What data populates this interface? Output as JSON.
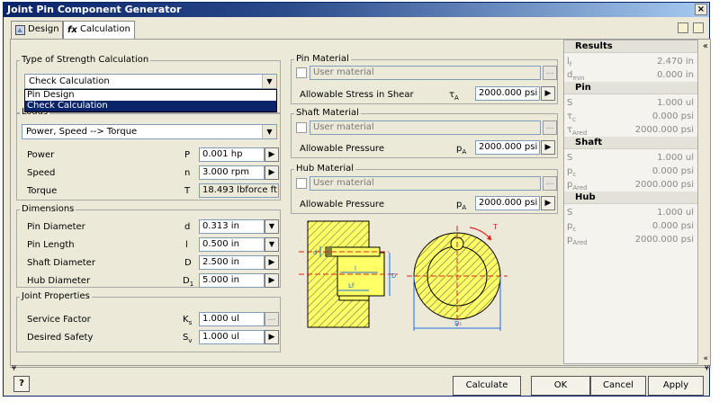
{
  "window": {
    "title": "Joint Pin Component Generator",
    "close_label": "×"
  },
  "tabs": [
    {
      "label": "Design",
      "icon": "design-tab-icon"
    },
    {
      "label": "Calculation",
      "icon": "function-fx-icon",
      "glyph": "fx"
    }
  ],
  "strength": {
    "title": "Type of Strength Calculation",
    "selected": "Check Calculation",
    "options": [
      "Pin Design",
      "Check Calculation"
    ]
  },
  "loads": {
    "title": "Loads",
    "selected": "Power, Speed --> Torque",
    "rows": [
      {
        "label": "Power",
        "symbol": "P",
        "value": "0.001 hp"
      },
      {
        "label": "Speed",
        "symbol": "n",
        "value": "3.000 rpm"
      },
      {
        "label": "Torque",
        "symbol": "T",
        "value": "18.493 lbforce ft"
      }
    ]
  },
  "dimensions": {
    "title": "Dimensions",
    "rows": [
      {
        "label": "Pin Diameter",
        "symbol": "d",
        "value": "0.313 in"
      },
      {
        "label": "Pin Length",
        "symbol": "l",
        "value": "0.500 in"
      },
      {
        "label": "Shaft Diameter",
        "symbol": "D",
        "value": "2.500 in"
      },
      {
        "label": "Hub Diameter",
        "symbol": "D",
        "sub": "1",
        "value": "5.000 in"
      }
    ]
  },
  "joint": {
    "title": "Joint Properties",
    "rows": [
      {
        "label": "Service Factor",
        "symbol": "K",
        "sub": "s",
        "value": "1.000 ul"
      },
      {
        "label": "Desired Safety",
        "symbol": "S",
        "sub": "v",
        "value": "1.000 ul"
      }
    ]
  },
  "pin_material": {
    "title": "Pin Material",
    "user_material": "User material",
    "label": "Allowable Stress in Shear",
    "symbol": "τ",
    "sub": "A",
    "value": "2000.000 psi"
  },
  "shaft_material": {
    "title": "Shaft Material",
    "user_material": "User material",
    "label": "Allowable Pressure",
    "symbol": "p",
    "sub": "A",
    "value": "2000.000 psi"
  },
  "hub_material": {
    "title": "Hub Material",
    "user_material": "User material",
    "label": "Allowable Pressure",
    "symbol": "p",
    "sub": "A",
    "value": "2000.000 psi"
  },
  "diagram": {
    "labels": {
      "d": "d",
      "l": "l",
      "lf": "Lf",
      "D": "D",
      "D1": "D₁",
      "T": "T"
    },
    "colors": {
      "fill": "#ffff66",
      "dim": "#1e6fe0",
      "center": "#e02020"
    }
  },
  "results": {
    "header": "Results",
    "rows": [
      {
        "k": "l",
        "sub": "f",
        "v": "2.470 in"
      },
      {
        "k": "d",
        "sub": "min",
        "v": "0.000 in"
      }
    ],
    "sections": [
      {
        "title": "Pin",
        "rows": [
          {
            "k": "S",
            "sub": "",
            "v": "1.000 ul"
          },
          {
            "k": "τ",
            "sub": "c",
            "v": "0.000 psi"
          },
          {
            "k": "τ",
            "sub": "Ared",
            "v": "2000.000 psi"
          }
        ]
      },
      {
        "title": "Shaft",
        "rows": [
          {
            "k": "S",
            "sub": "",
            "v": "1.000 ul"
          },
          {
            "k": "p",
            "sub": "c",
            "v": "0.000 psi"
          },
          {
            "k": "p",
            "sub": "Ared",
            "v": "2000.000 psi"
          }
        ]
      },
      {
        "title": "Hub",
        "rows": [
          {
            "k": "S",
            "sub": "",
            "v": "1.000 ul"
          },
          {
            "k": "p",
            "sub": "c",
            "v": "0.000 psi"
          },
          {
            "k": "p",
            "sub": "Ared",
            "v": "2000.000 psi"
          }
        ]
      }
    ]
  },
  "footer": {
    "help": "?",
    "calculate": "Calculate",
    "ok": "OK",
    "cancel": "Cancel",
    "apply": "Apply"
  }
}
